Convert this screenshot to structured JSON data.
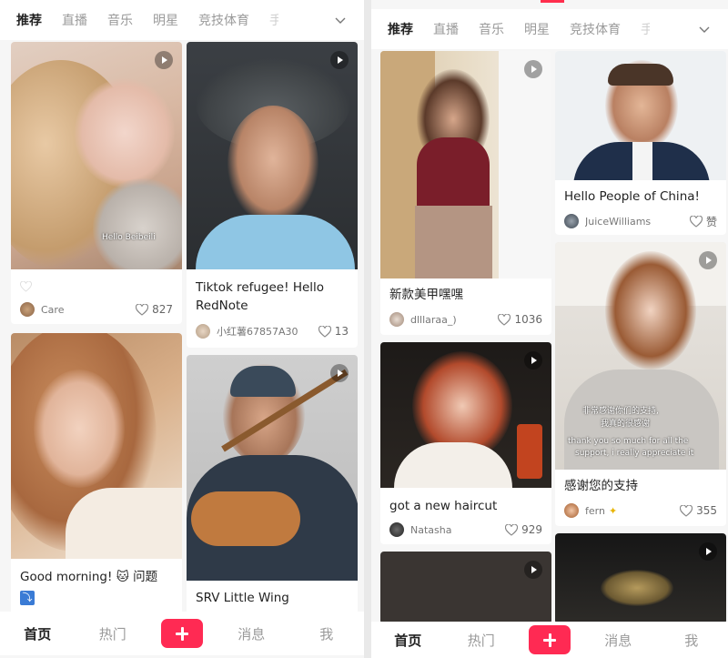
{
  "tabs": [
    "推荐",
    "直播",
    "音乐",
    "明星",
    "竞技体育",
    "手"
  ],
  "bottom_nav": {
    "home": "首页",
    "hot": "热门",
    "messages": "消息",
    "me": "我"
  },
  "icons": {
    "play": "play-icon",
    "heart": "heart-icon",
    "chevron": "chevron-down-icon",
    "plus": "plus-icon"
  },
  "colors": {
    "accent": "#ff2a53"
  },
  "left_feed": {
    "card1": {
      "author": "Care",
      "likes": "827",
      "overlay": "Hello Beibeili"
    },
    "card2": {
      "title": "Tiktok refugee! Hello RedNote",
      "author": "小红薯67857A30",
      "likes": "13"
    },
    "card3": {
      "title": "Good morning! 🐱 问题",
      "badge": "⤵"
    },
    "card4": {
      "title": "SRV Little Wing"
    }
  },
  "right_feed": {
    "card1": {
      "title": "新款美甲嘿嘿",
      "author": "dlllaraa_)",
      "likes": "1036"
    },
    "card2": {
      "title": "Hello People of China!",
      "author": "JuiceWilliams",
      "likes": "赞"
    },
    "card3": {
      "title": "got a new haircut",
      "author": "Natasha",
      "likes": "929"
    },
    "card4": {
      "title": "感谢您的支持",
      "author": "fern",
      "likes": "355",
      "subtitle1": "非常感谢你们的支持,",
      "subtitle2": "我真的很感谢",
      "subtitle3": "thank you so much for all the",
      "subtitle4": "support, i really appreciate it"
    }
  }
}
